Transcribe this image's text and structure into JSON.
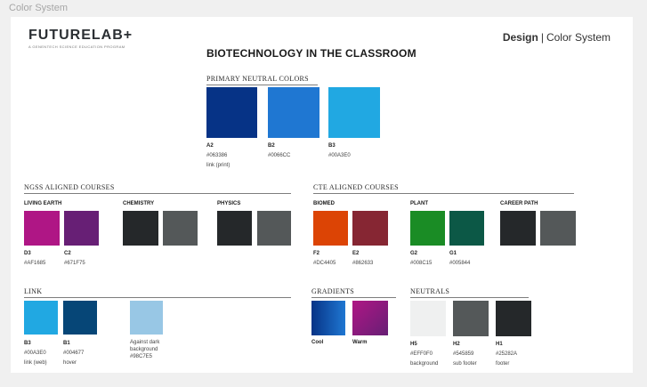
{
  "frame_label": "Color System",
  "brand": {
    "logo": "FUTURELAB+",
    "tagline": "A GENENTECH SCIENCE EDUCATION PROGRAM",
    "header_bold": "Design",
    "header_rest": "Color System",
    "title": "BIOTECHNOLOGY IN THE CLASSROOM"
  },
  "primary": {
    "heading": "PRIMARY NEUTRAL COLORS",
    "swatches": [
      {
        "code": "A2",
        "hex": "#063386",
        "note": "link (print)",
        "color": "#063386"
      },
      {
        "code": "B2",
        "hex": "#0066CC",
        "note": "",
        "color": "#1f77d2"
      },
      {
        "code": "B3",
        "hex": "#00A3E0",
        "note": "",
        "color": "#21a8e2"
      }
    ]
  },
  "ngss": {
    "heading": "NGSS ALIGNED COURSES",
    "groups": [
      "LIVING EARTH",
      "CHEMISTRY",
      "PHYSICS"
    ],
    "swatches": [
      {
        "code": "D3",
        "hex": "#AF1685",
        "color": "#af1685"
      },
      {
        "code": "C2",
        "hex": "#671F75",
        "color": "#671f75"
      },
      {
        "code": "",
        "hex": "",
        "color": "#25282a"
      },
      {
        "code": "",
        "hex": "",
        "color": "#545859"
      },
      {
        "code": "",
        "hex": "",
        "color": "#25282a"
      },
      {
        "code": "",
        "hex": "",
        "color": "#545859"
      }
    ]
  },
  "cte": {
    "heading": "CTE ALIGNED COURSES",
    "groups": [
      "BIOMED",
      "PLANT",
      "CAREER PATH"
    ],
    "swatches": [
      {
        "code": "F2",
        "hex": "#DC4405",
        "color": "#dc4405"
      },
      {
        "code": "E2",
        "hex": "#862633",
        "color": "#862633"
      },
      {
        "code": "G2",
        "hex": "#008C15",
        "color": "#1a8c25"
      },
      {
        "code": "G1",
        "hex": "#005844",
        "color": "#0c5846"
      },
      {
        "code": "",
        "hex": "",
        "color": "#25282a"
      },
      {
        "code": "",
        "hex": "",
        "color": "#545859"
      }
    ]
  },
  "link": {
    "heading": "LINK",
    "swatches": [
      {
        "code": "B3",
        "hex": "#00A3E0",
        "note": "link (web)",
        "color": "#21a8e2"
      },
      {
        "code": "B1",
        "hex": "#004677",
        "note": "hover",
        "color": "#064677"
      },
      {
        "code": "",
        "hex": "#98C7E5",
        "note": "Against dark",
        "note2": "background",
        "color": "#98c7e5"
      }
    ]
  },
  "gradients": {
    "heading": "GRADIENTS",
    "items": [
      {
        "label": "Cool",
        "from": "#063386",
        "to": "#1f77d2"
      },
      {
        "label": "Warm",
        "from": "#af1685",
        "to": "#671f75"
      }
    ]
  },
  "neutrals": {
    "heading": "NEUTRALS",
    "swatches": [
      {
        "code": "H5",
        "hex": "#EFF0F0",
        "note": "background",
        "color": "#eff0f0"
      },
      {
        "code": "H2",
        "hex": "#545859",
        "note": "sub footer",
        "color": "#545859"
      },
      {
        "code": "H1",
        "hex": "#25282A",
        "note": "footer",
        "color": "#25282a"
      }
    ]
  }
}
